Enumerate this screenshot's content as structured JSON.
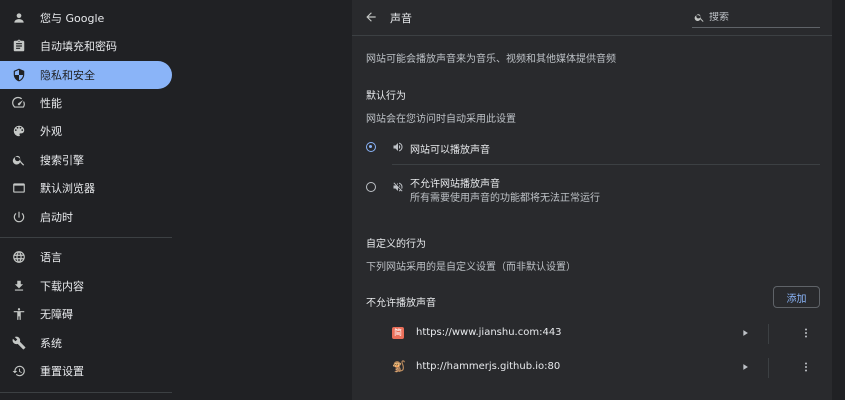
{
  "sidebar": {
    "items": [
      {
        "label": "您与 Google",
        "icon": "person-icon"
      },
      {
        "label": "自动填充和密码",
        "icon": "clipboard-icon"
      },
      {
        "label": "隐私和安全",
        "icon": "shield-icon",
        "active": true
      },
      {
        "label": "性能",
        "icon": "speedometer-icon"
      },
      {
        "label": "外观",
        "icon": "palette-icon"
      },
      {
        "label": "搜索引擎",
        "icon": "search-icon"
      },
      {
        "label": "默认浏览器",
        "icon": "browser-icon"
      },
      {
        "label": "启动时",
        "icon": "power-icon"
      },
      {
        "label": "语言",
        "icon": "globe-icon"
      },
      {
        "label": "下载内容",
        "icon": "download-icon"
      },
      {
        "label": "无障碍",
        "icon": "accessibility-icon"
      },
      {
        "label": "系统",
        "icon": "wrench-icon"
      },
      {
        "label": "重置设置",
        "icon": "reset-icon"
      }
    ]
  },
  "header": {
    "title": "声音",
    "search_placeholder": "搜索"
  },
  "content": {
    "description": "网站可能会播放声音来为音乐、视频和其他媒体提供音频",
    "default_behavior_heading": "默认行为",
    "default_behavior_desc": "网站会在您访问时自动采用此设置",
    "options": [
      {
        "label": "网站可以播放声音",
        "checked": true,
        "icon": "speaker-icon"
      },
      {
        "label": "不允许网站播放声音",
        "sub": "所有需要使用声音的功能都将无法正常运行",
        "checked": false,
        "icon": "speaker-muted-icon"
      }
    ],
    "custom_heading": "自定义的行为",
    "custom_desc": "下列网站采用的是自定义设置（而非默认设置）",
    "block_heading": "不允许播放声音",
    "add_button": "添加",
    "sites": [
      {
        "url": "https://www.jianshu.com:443",
        "favicon": "简"
      },
      {
        "url": "http://hammerjs.github.io:80",
        "favicon": "🐒"
      }
    ]
  },
  "colors": {
    "accent": "#8ab4f8",
    "background": "#202124",
    "card": "#292a2d"
  }
}
